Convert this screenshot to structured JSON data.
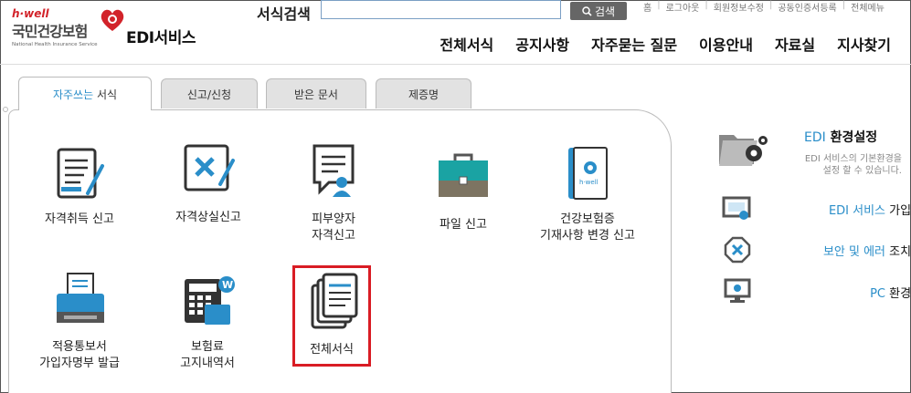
{
  "logo": {
    "brand": "h·well",
    "korean_name": "국민건강보험",
    "english_name": "National Health Insurance Service"
  },
  "service_title": "EDI서비스",
  "search": {
    "label": "서식검색",
    "value": "",
    "button": "검색"
  },
  "top_menu": [
    "홈",
    "로그아웃",
    "회원정보수정",
    "공동인증서등록",
    "전체메뉴"
  ],
  "main_nav": [
    "전체서식",
    "공지사항",
    "자주묻는 질문",
    "이용안내",
    "자료실",
    "지사찾기"
  ],
  "tabs": [
    {
      "highlight": "자주쓰는",
      "label": " 서식"
    },
    {
      "highlight": "",
      "label": "신고/신청"
    },
    {
      "highlight": "",
      "label": "받은 문서"
    },
    {
      "highlight": "",
      "label": "제증명"
    }
  ],
  "items": [
    {
      "label": "자격취득 신고",
      "icon": "document-pen-icon"
    },
    {
      "label": "자격상실신고",
      "icon": "document-x-icon"
    },
    {
      "label": "피부양자\n자격신고",
      "icon": "speech-person-icon"
    },
    {
      "label": "파일 신고",
      "icon": "briefcase-icon"
    },
    {
      "label": "건강보험증\n기재사항 변경 신고",
      "icon": "insurance-card-icon"
    },
    {
      "label": "적용통보서\n가입자명부 발급",
      "icon": "printer-icon"
    },
    {
      "label": "보험료\n고지내역서",
      "icon": "calculator-icon"
    },
    {
      "label": "전체서식",
      "icon": "document-stack-icon"
    }
  ],
  "side": {
    "env_title_blue": "EDI",
    "env_title": " 환경설정",
    "env_desc": "EDI 서비스의 기본환경을\n설정 할 수 있습니다.",
    "links": [
      {
        "blue": "EDI 서비스",
        "text": " 가입절차",
        "icon": "monitor-touch-icon"
      },
      {
        "blue": "보안 및 에러",
        "text": " 조치방법",
        "icon": "error-x-icon"
      },
      {
        "blue": "PC",
        "text": " 환경설정",
        "icon": "pc-settings-icon"
      }
    ]
  },
  "colors": {
    "accent_blue": "#2a8ec9",
    "logo_red": "#d2232a",
    "highlight_red": "#d91c24",
    "teal": "#1aa3a3"
  }
}
